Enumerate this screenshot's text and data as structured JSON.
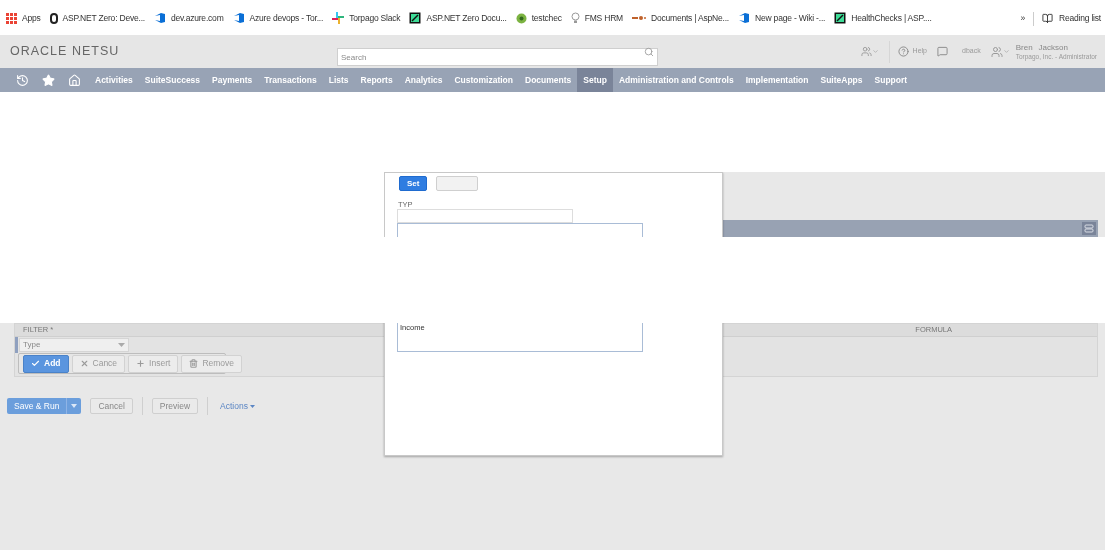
{
  "bookmarks": [
    {
      "label": "Apps",
      "kind": "apps"
    },
    {
      "label": "ASP.NET Zero: Deve...",
      "kind": "zero"
    },
    {
      "label": "dev.azure.com",
      "kind": "azure"
    },
    {
      "label": "Azure devops - Tor...",
      "kind": "azure"
    },
    {
      "label": "Torpago Slack",
      "kind": "slack"
    },
    {
      "label": "ASP.NET Zero Docu...",
      "kind": "square"
    },
    {
      "label": "testchec",
      "kind": "globe"
    },
    {
      "label": "FMS HRM",
      "kind": "bulb"
    },
    {
      "label": "Documents | AspNe...",
      "kind": "docs"
    },
    {
      "label": "New page - Wiki -...",
      "kind": "azure"
    },
    {
      "label": "HealthChecks | ASP....",
      "kind": "square"
    }
  ],
  "bookmarks_more": "»",
  "reading_list": "Reading list",
  "header": {
    "logo": "ORACLE NETSU",
    "search_placeholder": "Search",
    "help": "Help",
    "feedback": "dback",
    "user_name_start": "Bren",
    "user_name_end": "Jackson",
    "user_role": "Torpago, Inc. - Administrator"
  },
  "nav": [
    {
      "label": "Activities",
      "selected": false
    },
    {
      "label": "SuiteSuccess",
      "selected": false
    },
    {
      "label": "Payments",
      "selected": false
    },
    {
      "label": "Transactions",
      "selected": false
    },
    {
      "label": "Lists",
      "selected": false
    },
    {
      "label": "Reports",
      "selected": false
    },
    {
      "label": "Analytics",
      "selected": false
    },
    {
      "label": "Customization",
      "selected": false
    },
    {
      "label": "Documents",
      "selected": false
    },
    {
      "label": "Setup",
      "selected": true
    },
    {
      "label": "Administration and Controls",
      "selected": false
    },
    {
      "label": "Implementation",
      "selected": false
    },
    {
      "label": "SuiteApps",
      "selected": false
    },
    {
      "label": "Support",
      "selected": false
    }
  ],
  "filter": {
    "column_1": "FILTER *",
    "column_2": "FORMULA",
    "type_select": "Type",
    "buttons": [
      {
        "label": "Add",
        "kind": "add"
      },
      {
        "label": "Cance",
        "kind": "cancel"
      },
      {
        "label": "Insert",
        "kind": "insert"
      },
      {
        "label": "Remove",
        "kind": "remove"
      }
    ]
  },
  "footer": {
    "save_run": "Save & Run",
    "cancel": "Cancel",
    "preview": "Preview",
    "actions": "Actions"
  },
  "modal": {
    "set": "Set",
    "field_label": "TYP",
    "list_items": [
      "Income"
    ]
  }
}
